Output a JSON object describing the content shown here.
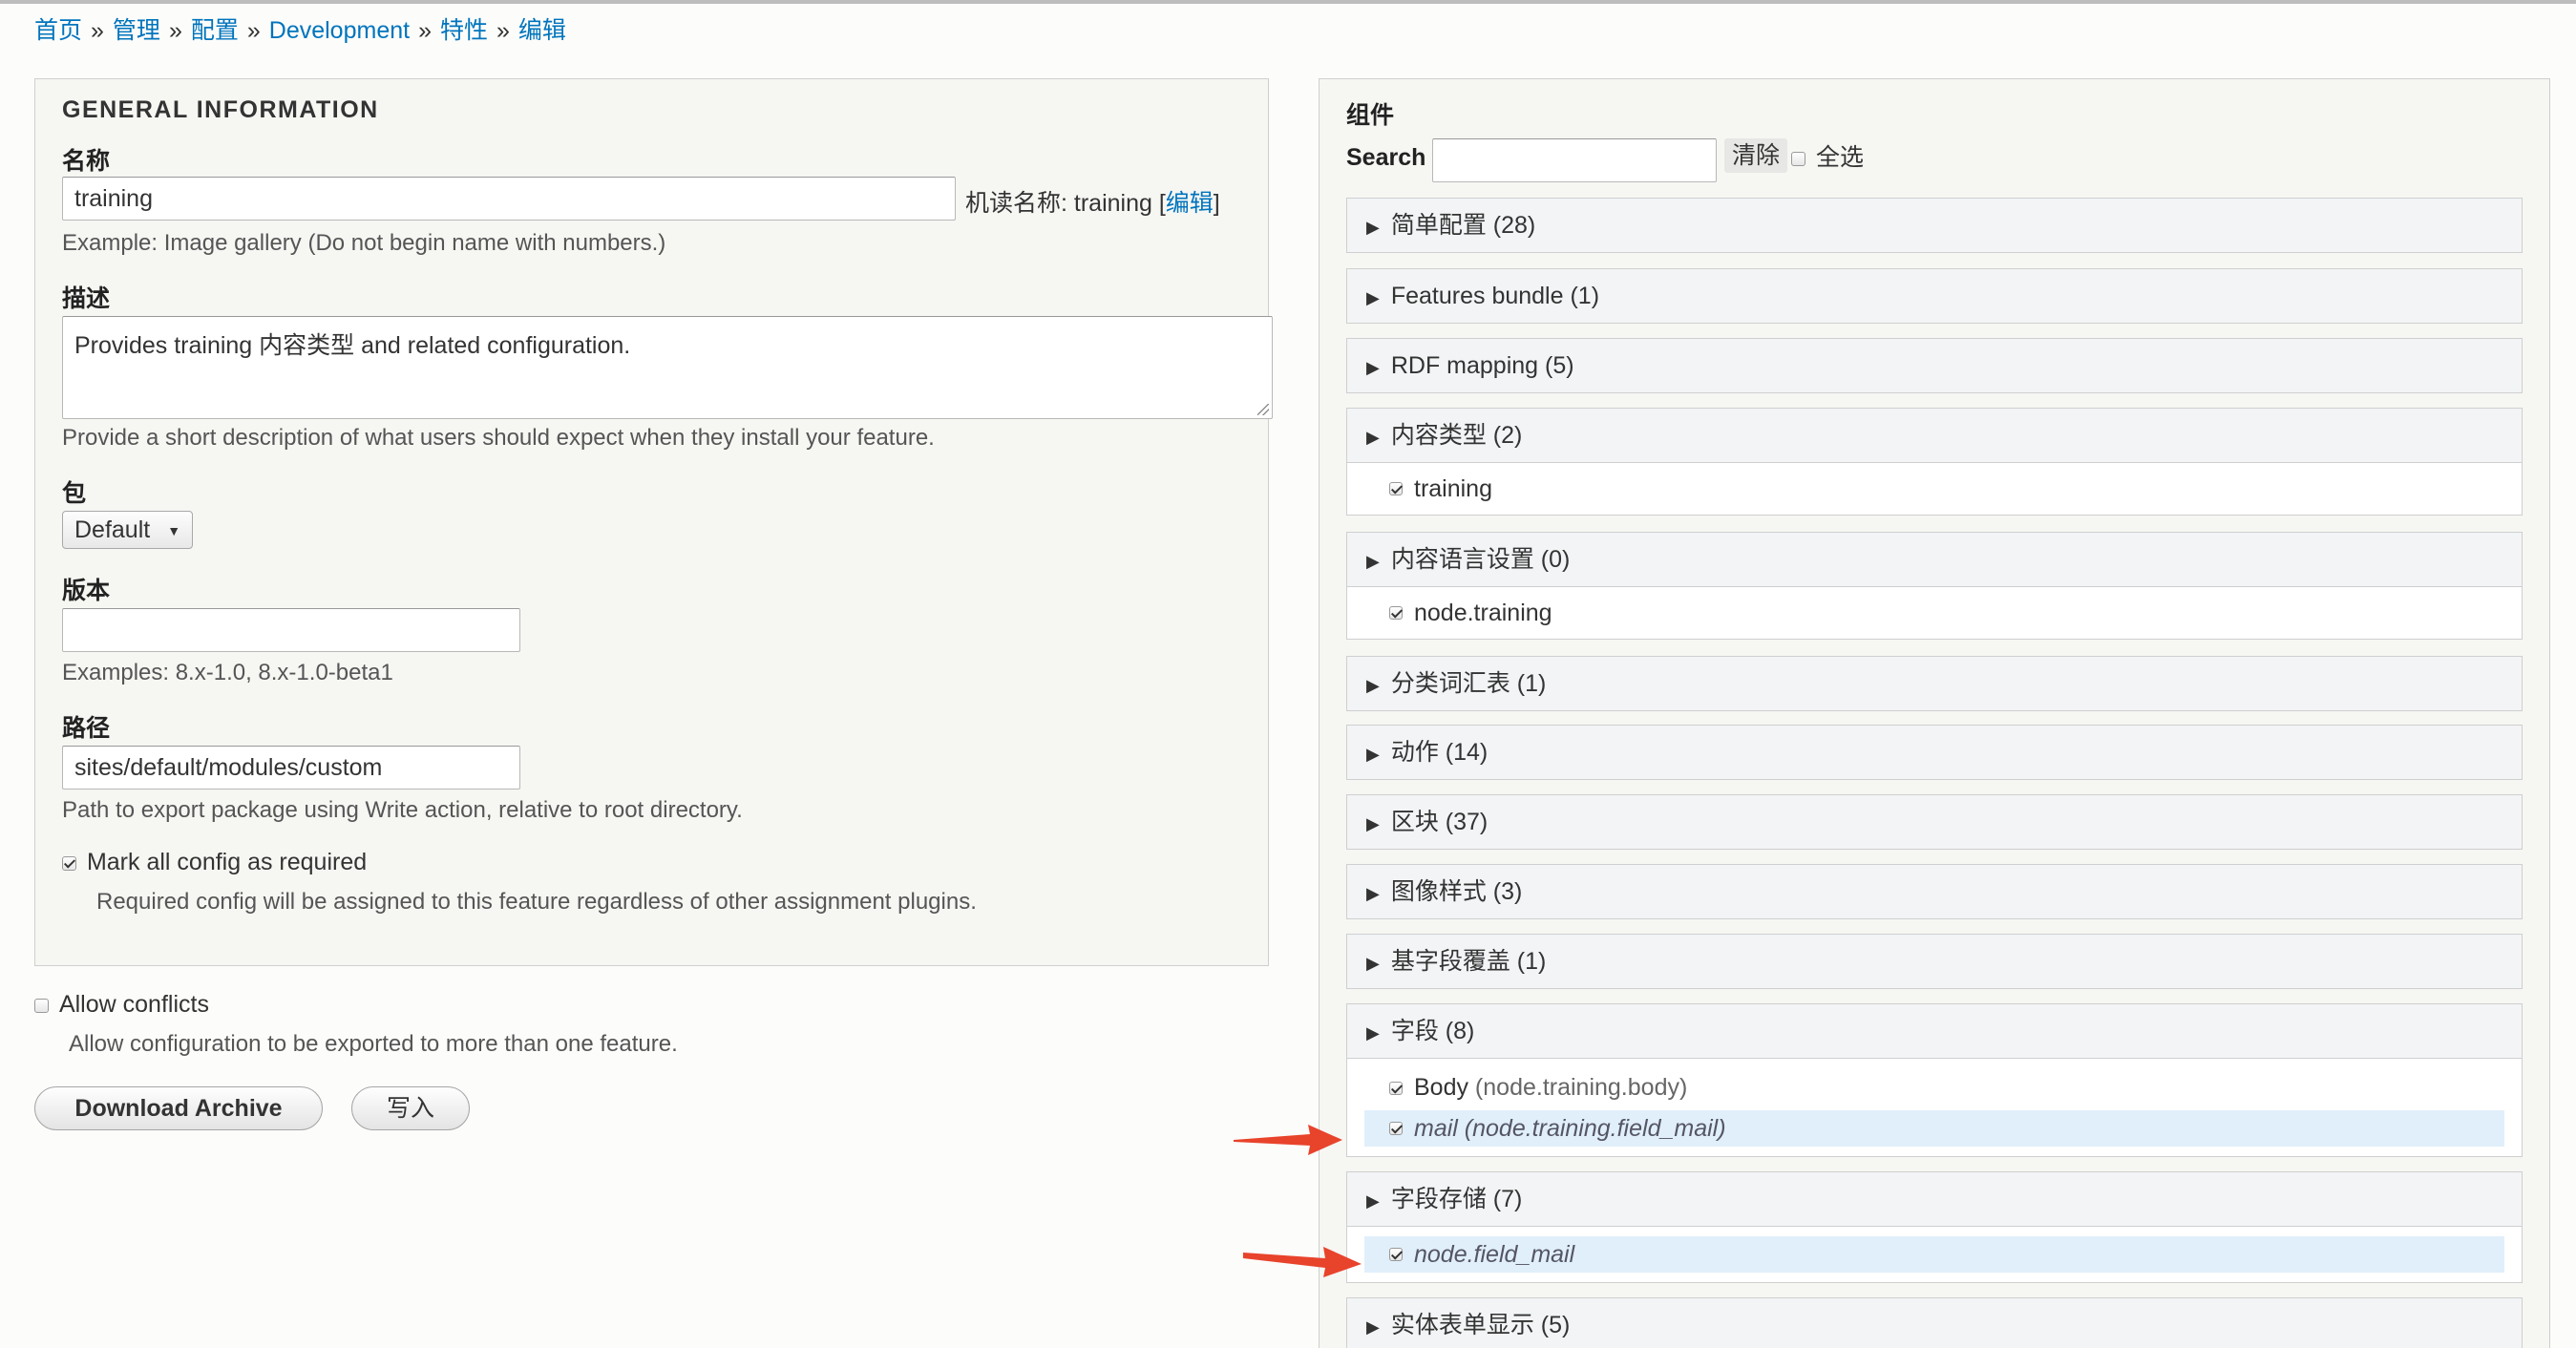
{
  "breadcrumb": {
    "items": [
      "首页",
      "管理",
      "配置",
      "Development",
      "特性",
      "编辑"
    ],
    "separator": "»"
  },
  "general": {
    "legend": "GENERAL INFORMATION",
    "name_label": "名称",
    "name_value": "training",
    "machine_name_prefix": "机读名称: training [",
    "machine_name_edit": "编辑",
    "machine_name_suffix": "]",
    "name_help": "Example: Image gallery (Do not begin name with numbers.)",
    "description_label": "描述",
    "description_value": "Provides training 内容类型 and related configuration.",
    "description_help": "Provide a short description of what users should expect when they install your feature.",
    "package_label": "包",
    "package_value": "Default",
    "version_label": "版本",
    "version_value": "",
    "version_help": "Examples: 8.x-1.0, 8.x-1.0-beta1",
    "path_label": "路径",
    "path_value": "sites/default/modules/custom",
    "path_help": "Path to export package using Write action, relative to root directory.",
    "required_label": "Mark all config as required",
    "required_checked": true,
    "required_help": "Required config will be assigned to this feature regardless of other assignment plugins."
  },
  "conflicts": {
    "label": "Allow conflicts",
    "checked": false,
    "help": "Allow configuration to be exported to more than one feature."
  },
  "actions": {
    "download_label": "Download Archive",
    "write_label": "写入"
  },
  "components": {
    "legend": "组件",
    "search_label": "Search",
    "search_value": "",
    "clear_label": "清除",
    "select_all_label": "全选",
    "select_all_checked": false,
    "groups": [
      {
        "title": "简单配置 (28)",
        "items": []
      },
      {
        "title": "Features bundle (1)",
        "items": []
      },
      {
        "title": "RDF mapping (5)",
        "items": []
      },
      {
        "title": "内容类型 (2)",
        "items": [
          {
            "label": "training",
            "sub": "",
            "checked": true,
            "highlight": false
          }
        ]
      },
      {
        "title": "内容语言设置 (0)",
        "items": [
          {
            "label": "node.training",
            "sub": "",
            "checked": true,
            "highlight": false
          }
        ]
      },
      {
        "title": "分类词汇表 (1)",
        "items": []
      },
      {
        "title": "动作 (14)",
        "items": []
      },
      {
        "title": "区块 (37)",
        "items": []
      },
      {
        "title": "图像样式 (3)",
        "items": []
      },
      {
        "title": "基字段覆盖 (1)",
        "items": []
      },
      {
        "title": "字段 (8)",
        "items": [
          {
            "label": "Body",
            "sub": " (node.training.body)",
            "checked": true,
            "highlight": false
          },
          {
            "label": "mail (node.training.field_mail)",
            "sub": "",
            "checked": true,
            "highlight": true
          }
        ]
      },
      {
        "title": "字段存储 (7)",
        "items": [
          {
            "label": "node.field_mail",
            "sub": "",
            "checked": true,
            "highlight": true
          }
        ]
      },
      {
        "title": "实体表单显示 (5)",
        "items": []
      }
    ]
  },
  "annotations": {
    "arrow_color": "#e8432b"
  }
}
